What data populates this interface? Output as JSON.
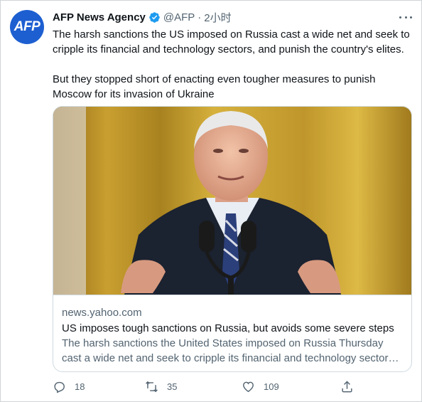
{
  "tweet": {
    "author_name": "AFP News Agency",
    "handle": "@AFP",
    "separator": "·",
    "time": "2小时",
    "avatar_text": "AFP",
    "avatar_color": "#1d5fd1",
    "verified_icon": "verified-badge-icon",
    "text_paragraphs": [
      "The harsh sanctions the US imposed on Russia cast a wide net and seek to cripple its financial and technology sectors, and punish the country's elites.",
      "But they stopped short of enacting even tougher measures to punish Moscow for its invasion of Ukraine"
    ]
  },
  "card": {
    "domain": "news.yahoo.com",
    "title": "US imposes tough sanctions on Russia, but avoids some severe steps",
    "description": "The harsh sanctions the United States imposed on Russia Thursday cast a wide net and seek to cripple its financial and technology sectors, and punish the country's elites."
  },
  "actions": {
    "reply_count": "18",
    "retweet_count": "35",
    "like_count": "109"
  },
  "colors": {
    "text_primary": "#0f1419",
    "text_secondary": "#536471",
    "accent": "#1d9bf0",
    "border": "#cfd9de"
  }
}
